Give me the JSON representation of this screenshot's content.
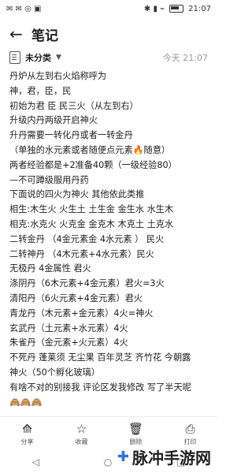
{
  "status": {
    "time": "21:07",
    "left_icons": "✉ ✉ ◎ ▣",
    "right_icons": "✱ ▮ ⌁"
  },
  "header": {
    "title": "笔记"
  },
  "meta": {
    "category": "未分类",
    "caret": "▼",
    "time": "今天 21:07"
  },
  "content": {
    "lines": [
      "丹炉从左到右火焰称呼为",
      "神，君，臣，民",
      "初始为君 臣 民三火（从左到右）",
      "升级内丹两级开启神火",
      "升丹需要一转化丹或者一转金丹",
      "（单独的水元素或者随便点元素🔥随意）",
      "两者经验都是+2准备40颗（一级经验80）",
      "—不可蹲级服用丹药",
      "下面说的四火为神火 其他依此类推",
      "相生:木生火 火生土 土生金 金生水 水生木",
      "相克:水克火 火克金 金克木 木克土 土克水",
      "二转金丹 （4金元素金 4水元素 ） 民火",
      "二转神丹 （4木元素+4水元素）民火",
      "无极丹 4金属性 君火",
      "涤阴丹（6木元素+4金元素）君火=3火",
      "清阳丹（6火元素+4金元素）君火",
      "青龙丹（木元素+金元素）4火=神火",
      "玄武丹（土元素+水元素）4火",
      "朱雀丹（金元素+火元素）4火",
      "不死丹 蓬莱须 无尘果 百年灵芝 齐竹花 今朝露",
      "神火（50个孵化玻璃）",
      "有啥不对的别接我 评论区发我修改 写了半天呢",
      "🙈🙈🙈"
    ]
  },
  "bottom": {
    "share": {
      "icon": "⟰",
      "label": "分享"
    },
    "favorite": {
      "icon": "☆",
      "label": "收藏"
    },
    "delete": {
      "icon": "🗑",
      "label": "删除"
    },
    "print": {
      "icon": "⎙",
      "label": "打印"
    }
  },
  "nav": {
    "back": "◁",
    "home": "○",
    "recent": "□"
  },
  "watermark": {
    "logo": "✚",
    "text": "脉冲手游网"
  }
}
